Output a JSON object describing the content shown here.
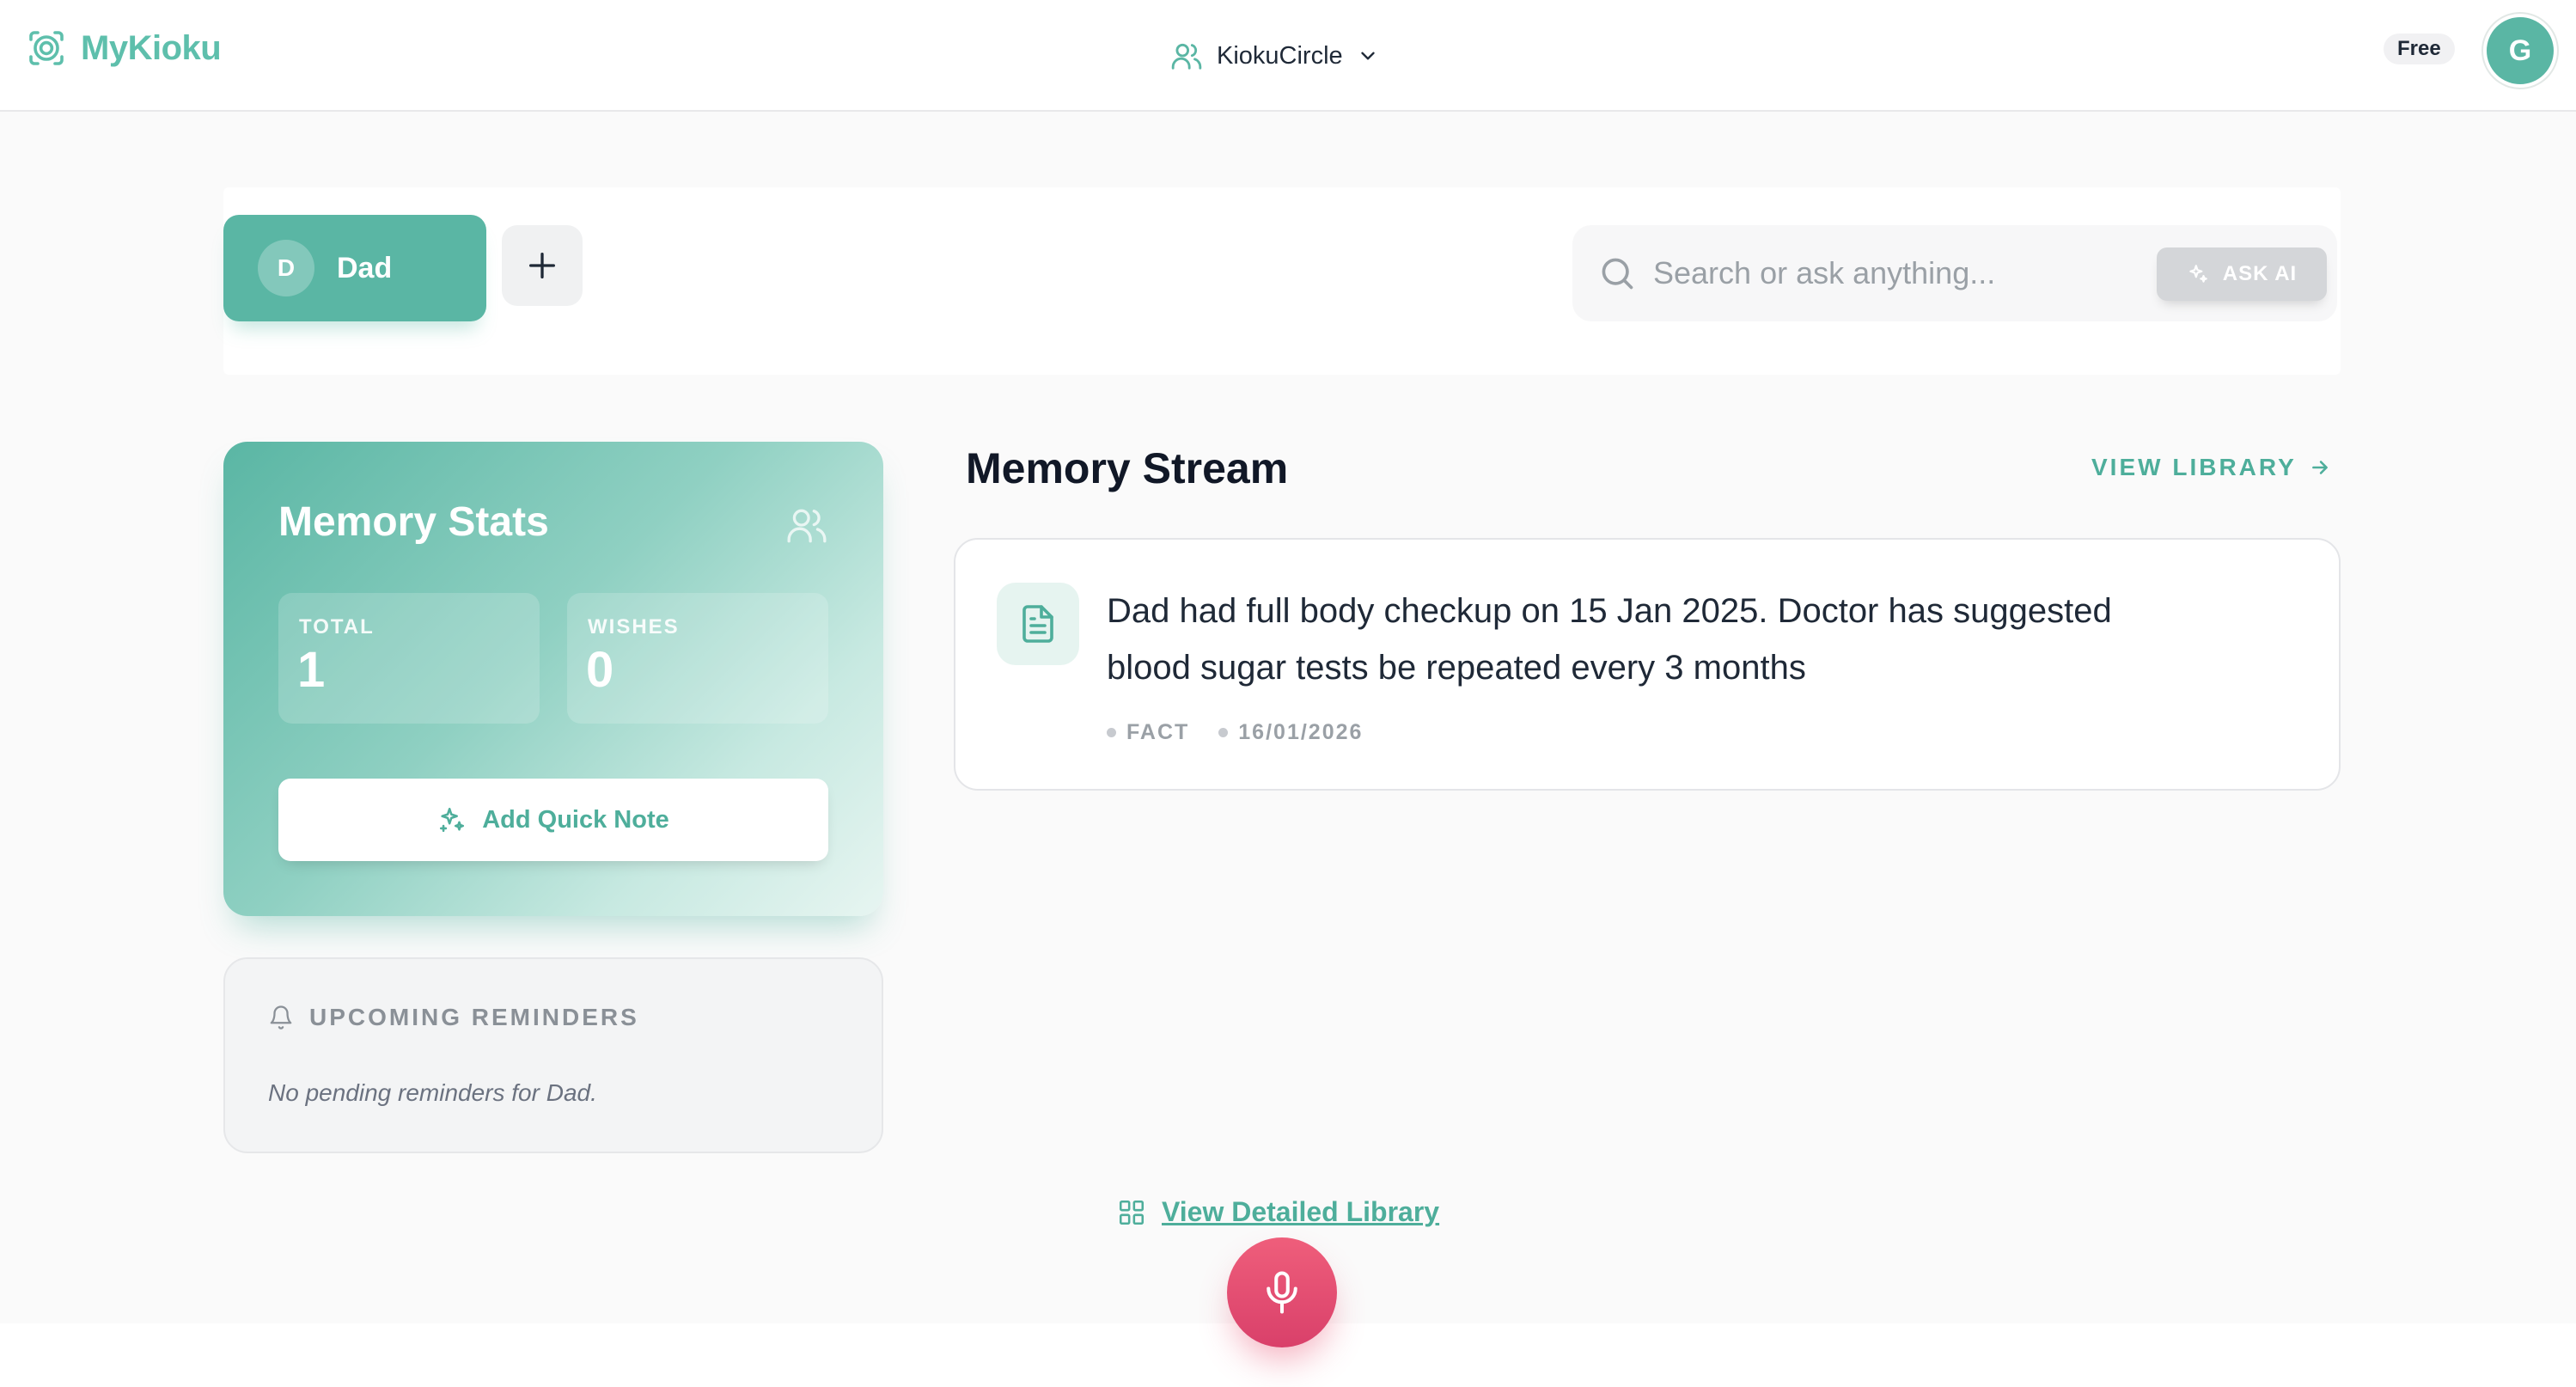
{
  "app": {
    "name": "MyKioku"
  },
  "header": {
    "circle_name": "KiokuCircle",
    "plan": "Free",
    "avatar_initial": "G"
  },
  "profiles": {
    "active": {
      "initial": "D",
      "name": "Dad"
    }
  },
  "search": {
    "placeholder": "Search or ask anything...",
    "ask_ai_label": "ASK AI"
  },
  "stats": {
    "title": "Memory Stats",
    "total_label": "TOTAL",
    "total_value": "1",
    "wishes_label": "WISHES",
    "wishes_value": "0",
    "quick_note_label": "Add Quick Note"
  },
  "reminders": {
    "title": "UPCOMING REMINDERS",
    "empty_text": "No pending reminders for Dad."
  },
  "stream": {
    "title": "Memory Stream",
    "view_library_label": "VIEW LIBRARY",
    "items": [
      {
        "text": "Dad had full body checkup on 15 Jan 2025. Doctor has suggested blood sugar tests be repeated every 3 months",
        "type": "FACT",
        "date": "16/01/2026"
      }
    ]
  },
  "footer": {
    "detailed_library_label": "View Detailed Library"
  },
  "colors": {
    "brand": "#5ab6a4",
    "brand_text": "#4eae9b",
    "mic": "#e25072"
  }
}
